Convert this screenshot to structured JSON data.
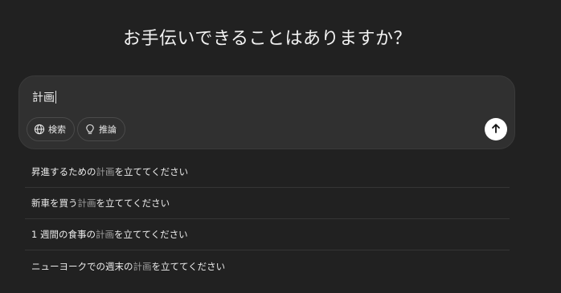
{
  "heading": "お手伝いできることはありますか？",
  "composer": {
    "value": "計画",
    "chips": [
      {
        "label": "検索",
        "icon": "globe-icon"
      },
      {
        "label": "推論",
        "icon": "lightbulb-icon"
      }
    ],
    "send_icon": "arrow-up-icon"
  },
  "suggestions": [
    {
      "before": "昇進するための",
      "highlight": "計画",
      "after": "を立ててください"
    },
    {
      "before": "新車を買う",
      "highlight": "計画",
      "after": "を立ててください"
    },
    {
      "before": "1 週間の食事の",
      "highlight": "計画",
      "after": "を立ててください"
    },
    {
      "before": "ニューヨークでの週末の",
      "highlight": "計画",
      "after": "を立ててください"
    }
  ]
}
